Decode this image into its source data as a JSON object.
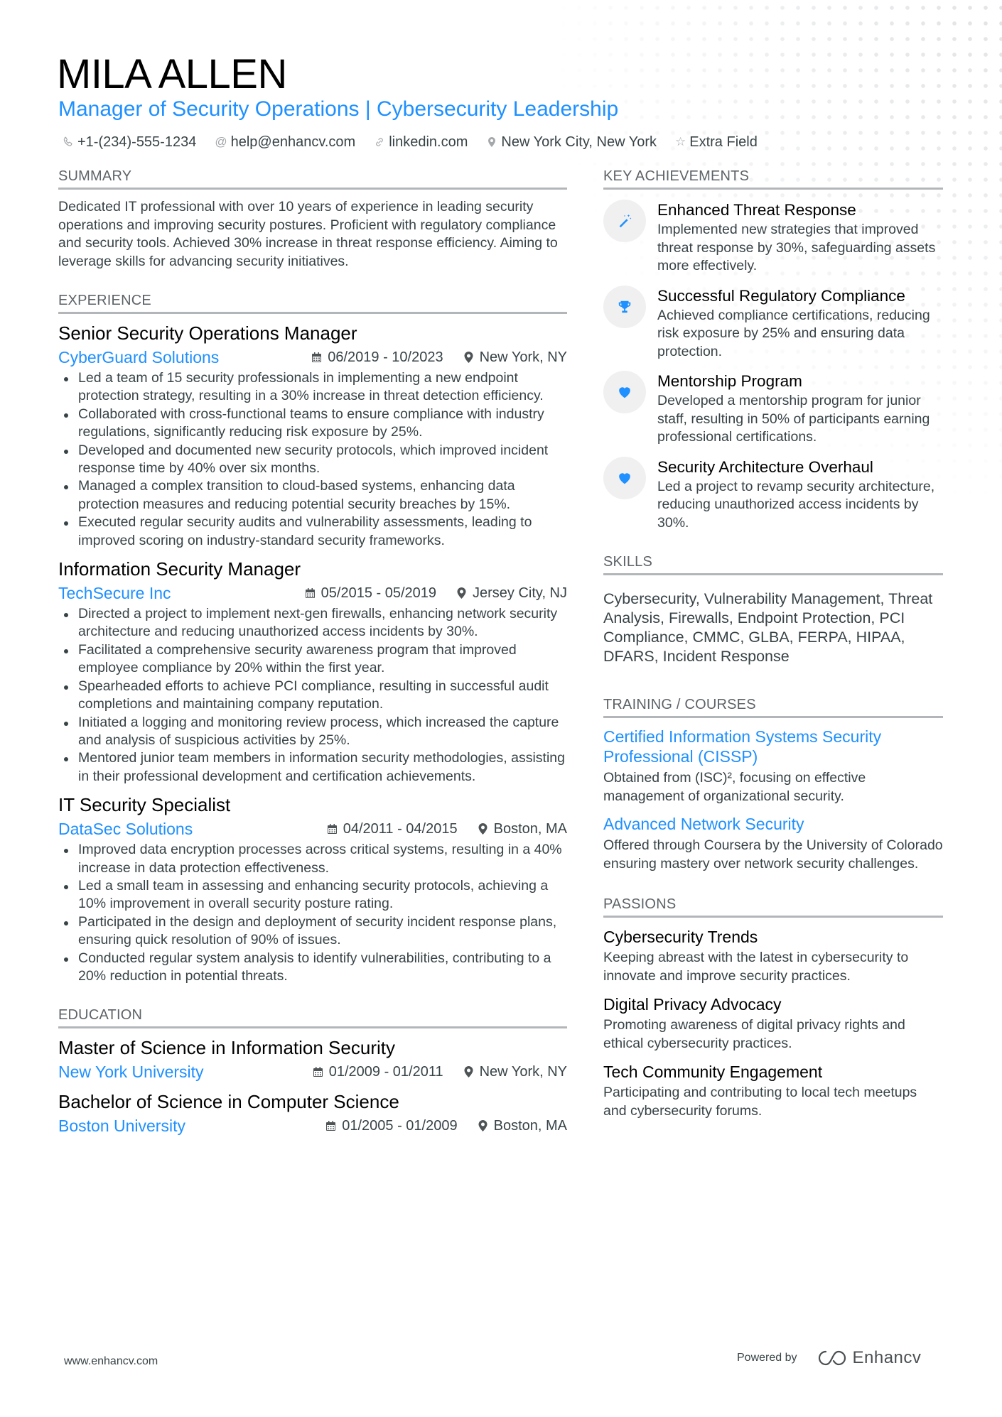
{
  "header": {
    "name": "MILA ALLEN",
    "role": "Manager of Security Operations | Cybersecurity Leadership",
    "contacts": [
      {
        "icon": "phone-icon",
        "text": "+1-(234)-555-1234"
      },
      {
        "icon": "at-icon",
        "text": "help@enhancv.com"
      },
      {
        "icon": "link-icon",
        "text": "linkedin.com"
      },
      {
        "icon": "location-icon",
        "text": "New York City, New York"
      },
      {
        "icon": "star-icon",
        "text": "Extra Field"
      }
    ]
  },
  "summary": {
    "title": "SUMMARY",
    "text": "Dedicated IT professional with over 10 years of experience in leading security operations and improving security postures. Proficient with regulatory compliance and security tools. Achieved 30% increase in threat response efficiency. Aiming to leverage skills for advancing security initiatives."
  },
  "experience": {
    "title": "EXPERIENCE",
    "jobs": [
      {
        "title": "Senior Security Operations Manager",
        "company": "CyberGuard Solutions",
        "dates": "06/2019 - 10/2023",
        "location": "New York, NY",
        "bullets": [
          "Led a team of 15 security professionals in implementing a new endpoint protection strategy, resulting in a 30% increase in threat detection efficiency.",
          "Collaborated with cross-functional teams to ensure compliance with industry regulations, significantly reducing risk exposure by 25%.",
          "Developed and documented new security protocols, which improved incident response time by 40% over six months.",
          "Managed a complex transition to cloud-based systems, enhancing data protection measures and reducing potential security breaches by 15%.",
          "Executed regular security audits and vulnerability assessments, leading to improved scoring on industry-standard security frameworks."
        ]
      },
      {
        "title": "Information Security Manager",
        "company": "TechSecure Inc",
        "dates": "05/2015 - 05/2019",
        "location": "Jersey City, NJ",
        "bullets": [
          "Directed a project to implement next-gen firewalls, enhancing network security architecture and reducing unauthorized access incidents by 30%.",
          "Facilitated a comprehensive security awareness program that improved employee compliance by 20% within the first year.",
          "Spearheaded efforts to achieve PCI compliance, resulting in successful audit completions and maintaining company reputation.",
          "Initiated a logging and monitoring review process, which increased the capture and analysis of suspicious activities by 25%.",
          "Mentored junior team members in information security methodologies, assisting in their professional development and certification achievements."
        ]
      },
      {
        "title": "IT Security Specialist",
        "company": "DataSec Solutions",
        "dates": "04/2011 - 04/2015",
        "location": "Boston, MA",
        "bullets": [
          "Improved data encryption processes across critical systems, resulting in a 40% increase in data protection effectiveness.",
          "Led a small team in assessing and enhancing security protocols, achieving a 10% improvement in overall security posture rating.",
          "Participated in the design and deployment of security incident response plans, ensuring quick resolution of 90% of issues.",
          "Conducted regular system analysis to identify vulnerabilities, contributing to a 20% reduction in potential threats."
        ]
      }
    ]
  },
  "education": {
    "title": "EDUCATION",
    "items": [
      {
        "degree": "Master of Science in Information Security",
        "school": "New York University",
        "dates": "01/2009 - 01/2011",
        "location": "New York, NY"
      },
      {
        "degree": "Bachelor of Science in Computer Science",
        "school": "Boston University",
        "dates": "01/2005 - 01/2009",
        "location": "Boston, MA"
      }
    ]
  },
  "achievements": {
    "title": "KEY ACHIEVEMENTS",
    "items": [
      {
        "icon": "magic-wand-icon",
        "title": "Enhanced Threat Response",
        "desc": "Implemented new strategies that improved threat response by 30%, safeguarding assets more effectively."
      },
      {
        "icon": "trophy-icon",
        "title": "Successful Regulatory Compliance",
        "desc": "Achieved compliance certifications, reducing risk exposure by 25% and ensuring data protection."
      },
      {
        "icon": "heart-icon",
        "title": "Mentorship Program",
        "desc": "Developed a mentorship program for junior staff, resulting in 50% of participants earning professional certifications."
      },
      {
        "icon": "heart-icon",
        "title": "Security Architecture Overhaul",
        "desc": "Led a project to revamp security architecture, reducing unauthorized access incidents by 30%."
      }
    ]
  },
  "skills": {
    "title": "SKILLS",
    "text": "Cybersecurity, Vulnerability Management, Threat Analysis, Firewalls, Endpoint Protection, PCI Compliance, CMMC, GLBA, FERPA, HIPAA, DFARS, Incident Response"
  },
  "training": {
    "title": "TRAINING / COURSES",
    "items": [
      {
        "title": "Certified Information Systems Security Professional (CISSP)",
        "desc": "Obtained from (ISC)², focusing on effective management of organizational security."
      },
      {
        "title": "Advanced Network Security",
        "desc": "Offered through Coursera by the University of Colorado ensuring mastery over network security challenges."
      }
    ]
  },
  "passions": {
    "title": "PASSIONS",
    "items": [
      {
        "title": "Cybersecurity Trends",
        "desc": "Keeping abreast with the latest in cybersecurity to innovate and improve security practices."
      },
      {
        "title": "Digital Privacy Advocacy",
        "desc": "Promoting awareness of digital privacy rights and ethical cybersecurity practices."
      },
      {
        "title": "Tech Community Engagement",
        "desc": "Participating and contributing to local tech meetups and cybersecurity forums."
      }
    ]
  },
  "footer": {
    "website": "www.enhancv.com",
    "powered_by": "Powered by",
    "brand": "Enhancv"
  },
  "colors": {
    "accent": "#1e90ff",
    "text": "#384347",
    "heading": "#000000",
    "section_title": "#5d6368",
    "rule": "#b3b6b9"
  }
}
